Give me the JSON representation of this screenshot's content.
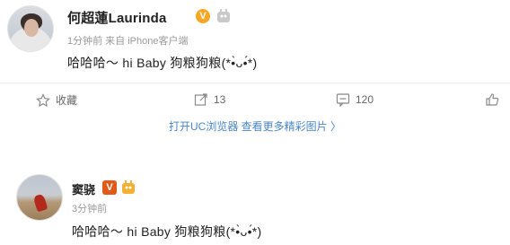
{
  "post1": {
    "username": "何超蓮Laurinda",
    "verified_badge": "V",
    "member_icon": "member-badge-icon",
    "meta": "1分钟前  来自 iPhone客户端",
    "text": "哈哈哈～ hi Baby 狗粮狗粮(*•̀ᴗ•́*)"
  },
  "actions": {
    "favorite_label": "收藏",
    "retweet_count": "13",
    "comment_count": "120"
  },
  "promo": {
    "text": "打开UC浏览器 查看更多精彩图片 〉"
  },
  "post2": {
    "username": "窦骁",
    "verified_badge": "V",
    "member_icon": "member-badge-icon",
    "meta": "3分钟前",
    "text": "哈哈哈～ hi Baby 狗粮狗粮(*•̀ᴗ•́*)"
  },
  "colors": {
    "link_blue": "#4a86c5",
    "badge_orange": "#f5a623",
    "badge_red": "#e05a1a",
    "meta_gray": "#999999"
  }
}
